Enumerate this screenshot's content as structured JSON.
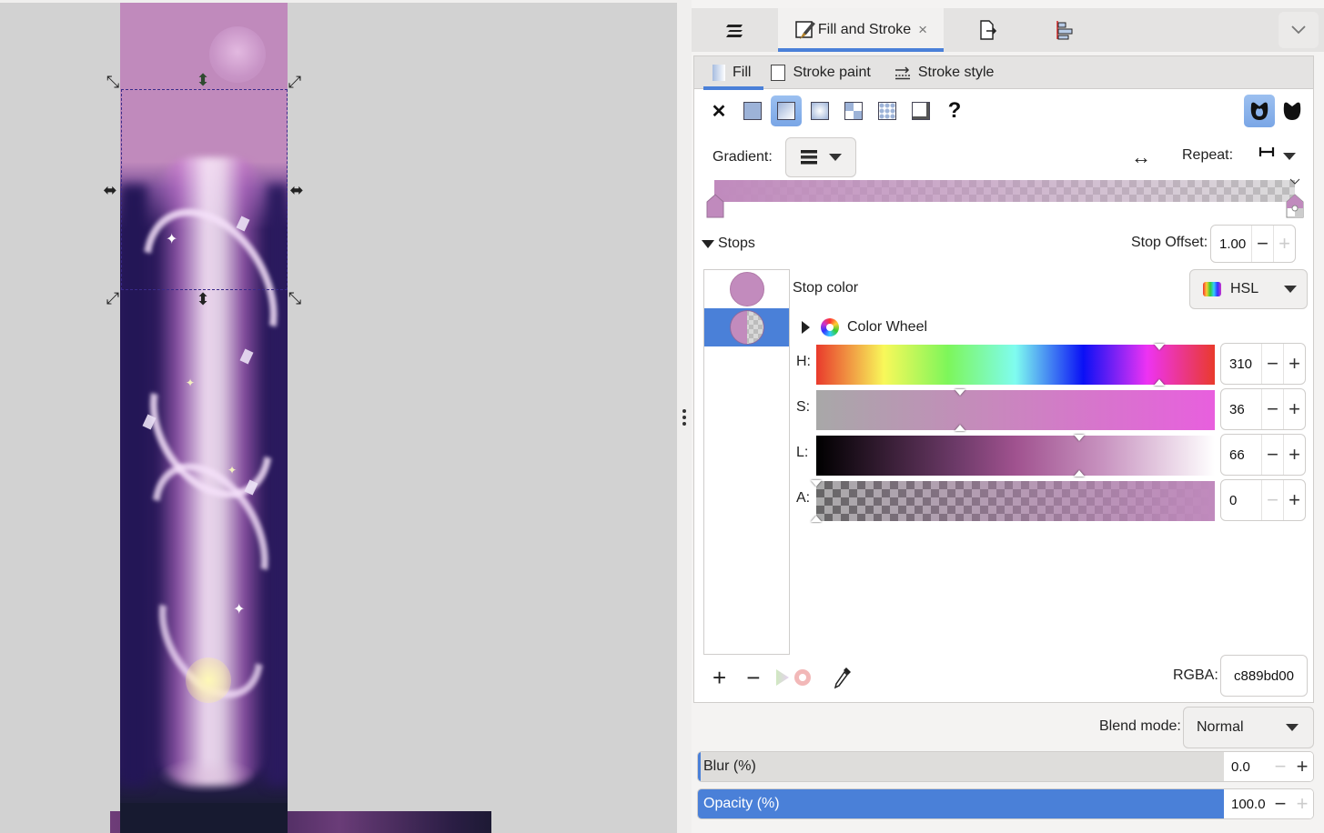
{
  "dock": {
    "tabs": [
      {
        "name": "layers",
        "icon": "layers-icon"
      },
      {
        "name": "fill-and-stroke",
        "label": "Fill and Stroke",
        "icon": "fill-stroke-icon",
        "active": true,
        "close": "×"
      },
      {
        "name": "export",
        "icon": "export-icon"
      },
      {
        "name": "align",
        "icon": "align-icon"
      }
    ],
    "menu_icon": "chevron-down-icon"
  },
  "fill_stroke": {
    "sub_tabs": [
      {
        "label": "Fill",
        "active": true
      },
      {
        "label": "Stroke paint"
      },
      {
        "label": "Stroke style"
      }
    ],
    "paint_types": [
      "no-paint",
      "flat-color",
      "linear-gradient",
      "radial-gradient",
      "mesh-gradient",
      "pattern",
      "swatch",
      "unset"
    ],
    "paint_active": "linear-gradient",
    "unset_label": "?",
    "fill_rules": {
      "evenodd": "even-odd",
      "nonzero": "nonzero",
      "active": "evenodd"
    },
    "gradient": {
      "label": "Gradient:",
      "reverse_icon": "↔",
      "repeat_label": "Repeat:",
      "repeat_icon": "⊢⊣",
      "start_color": "#c08abd",
      "end_color": "#c08abd00"
    },
    "stops": {
      "title": "Stops",
      "offset_label": "Stop Offset:",
      "offset_value": "1.00",
      "items": [
        {
          "color": "#c28bbd",
          "alpha": 1,
          "selected": false
        },
        {
          "color": "#c28bbd",
          "alpha": 0,
          "selected": true
        }
      ],
      "stop_color_label": "Stop color",
      "color_mode": "HSL",
      "color_wheel_label": "Color Wheel",
      "sliders": [
        {
          "label": "H:",
          "value": "310",
          "fraction": 0.861
        },
        {
          "label": "S:",
          "value": "36",
          "fraction": 0.36
        },
        {
          "label": "L:",
          "value": "66",
          "fraction": 0.66
        },
        {
          "label": "A:",
          "value": "0",
          "fraction": 0.0
        }
      ],
      "actions": [
        "+",
        "−"
      ],
      "rgba_label": "RGBA:",
      "rgba_value": "c889bd00"
    },
    "blend_label": "Blend mode:",
    "blend_value": "Normal",
    "blur": {
      "label": "Blur (%)",
      "value": "0.0",
      "fraction": 0.0
    },
    "opacity": {
      "label": "Opacity (%)",
      "value": "100.0",
      "fraction": 1.0
    }
  },
  "colors": {
    "accent": "#4a80d8",
    "stop_color": "#c889bd"
  }
}
